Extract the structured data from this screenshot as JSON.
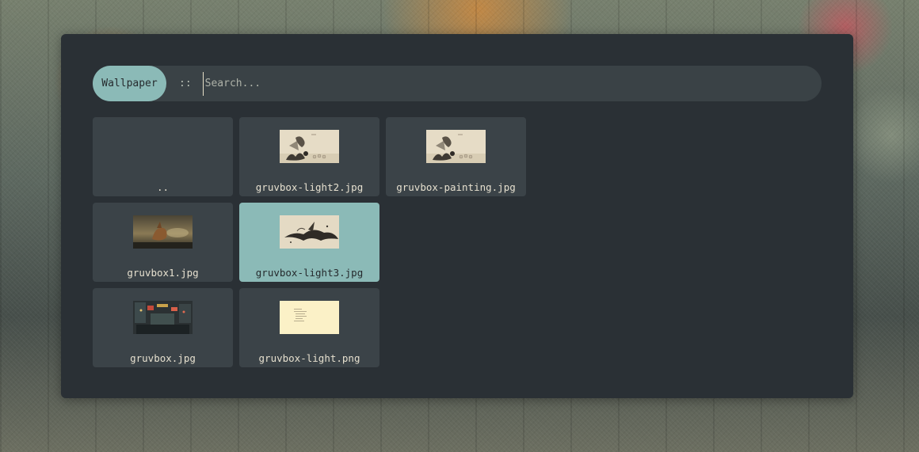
{
  "launcher": {
    "mode_label": "Wallpaper",
    "separator": "::",
    "search_placeholder": "Search...",
    "search_value": ""
  },
  "items": [
    {
      "label": "..",
      "thumbnail": "none",
      "selected": false
    },
    {
      "label": "gruvbox-light2.jpg",
      "thumbnail": "ink-painting-light",
      "selected": false
    },
    {
      "label": "gruvbox-painting.jpg",
      "thumbnail": "ink-painting-light",
      "selected": false
    },
    {
      "label": "gruvbox1.jpg",
      "thumbnail": "dark-landscape",
      "selected": false
    },
    {
      "label": "gruvbox-light3.jpg",
      "thumbnail": "ink-splash-light",
      "selected": true
    },
    {
      "label": "gruvbox.jpg",
      "thumbnail": "city-night",
      "selected": false
    },
    {
      "label": "gruvbox-light.png",
      "thumbnail": "text-on-cream",
      "selected": false
    }
  ],
  "colors": {
    "panel": "#2a3035",
    "search_bar": "#3a4246",
    "accent": "#8bbab7",
    "tile": "#3b4348",
    "text": "#e6e0cf"
  }
}
